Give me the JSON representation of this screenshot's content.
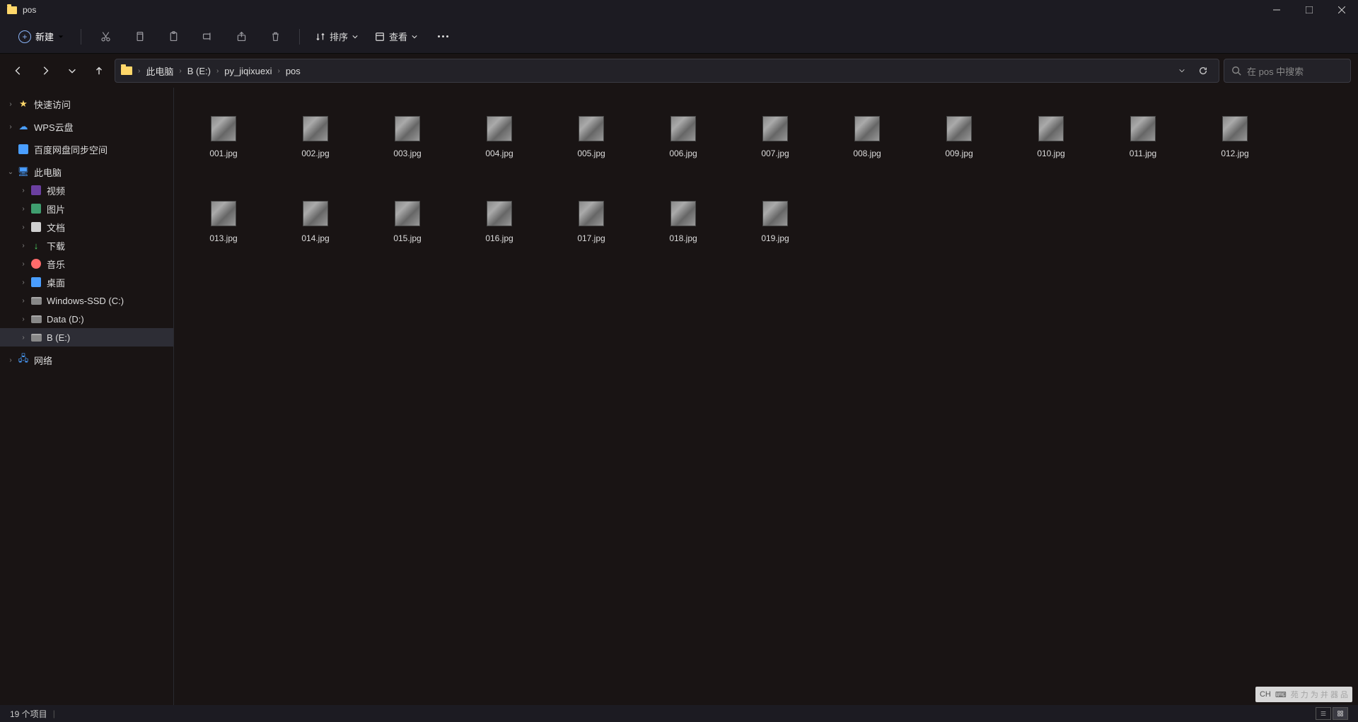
{
  "window": {
    "title": "pos"
  },
  "toolbar": {
    "new_label": "新建",
    "sort_label": "排序",
    "view_label": "查看"
  },
  "breadcrumb": [
    "此电脑",
    "B (E:)",
    "py_jiqixuexi",
    "pos"
  ],
  "search": {
    "placeholder": "在 pos 中搜索"
  },
  "sidebar": {
    "quick": "快速访问",
    "wps": "WPS云盘",
    "baidu": "百度网盘同步空间",
    "pc": "此电脑",
    "video": "视频",
    "pic": "图片",
    "doc": "文档",
    "dl": "下载",
    "music": "音乐",
    "desktop": "桌面",
    "drive_c": "Windows-SSD (C:)",
    "drive_d": "Data (D:)",
    "drive_e": "B (E:)",
    "net": "网络"
  },
  "files": [
    "001.jpg",
    "002.jpg",
    "003.jpg",
    "004.jpg",
    "005.jpg",
    "006.jpg",
    "007.jpg",
    "008.jpg",
    "009.jpg",
    "010.jpg",
    "011.jpg",
    "012.jpg",
    "013.jpg",
    "014.jpg",
    "015.jpg",
    "016.jpg",
    "017.jpg",
    "018.jpg",
    "019.jpg"
  ],
  "status": {
    "count": "19 个项目"
  },
  "ime": {
    "lang": "CH"
  }
}
